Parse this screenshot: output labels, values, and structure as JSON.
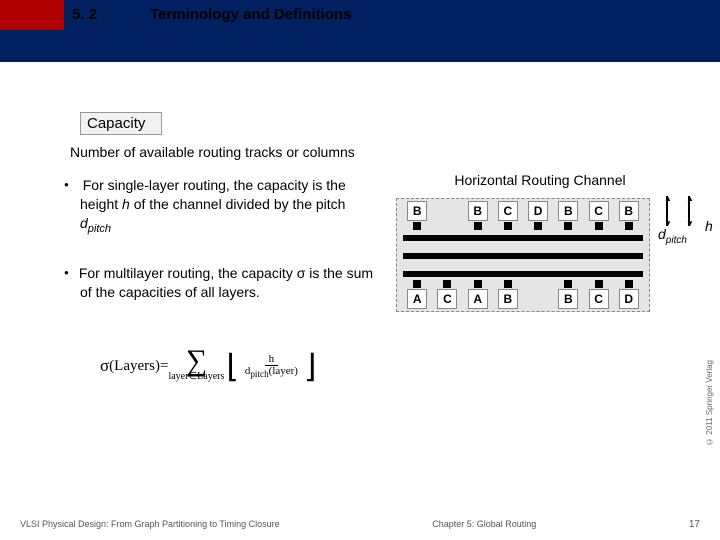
{
  "header": {
    "section_number": "5. 2",
    "section_title": "Terminology and Definitions"
  },
  "capacity_label": "Capacity",
  "subheading": "Number of available routing tracks or columns",
  "bullet1_a": "For single-layer routing, the capacity is the height ",
  "bullet1_h": "h",
  "bullet1_b": " of the channel divided by the pitch ",
  "bullet1_d": "d",
  "bullet1_dsub": "pitch",
  "bullet2": "For multilayer routing, the capacity σ is the sum of the capacities of all layers.",
  "formula": {
    "lhs_sigma": "σ",
    "lhs_arg": "(Layers)",
    "eq": " = ",
    "sum_top": "",
    "sum_bot": "layer∈Layers",
    "frac_top": "h",
    "frac_bot_a": "d",
    "frac_bot_sub": "pitch",
    "frac_bot_b": "(layer)"
  },
  "diagram": {
    "title": "Horizontal Routing Channel",
    "top_pins": [
      "B",
      "",
      "B",
      "C",
      "D",
      "B",
      "C",
      "B"
    ],
    "bottom_pins": [
      "A",
      "C",
      "A",
      "B",
      "",
      "B",
      "C",
      "D"
    ],
    "d_label": "d",
    "d_sub": "pitch",
    "h_label": "h"
  },
  "copyright": "© 2011 Springer Verlag",
  "footer": {
    "left": "VLSI Physical Design: From Graph Partitioning to Timing Closure",
    "center": "Chapter 5: Global Routing",
    "page": "17"
  }
}
